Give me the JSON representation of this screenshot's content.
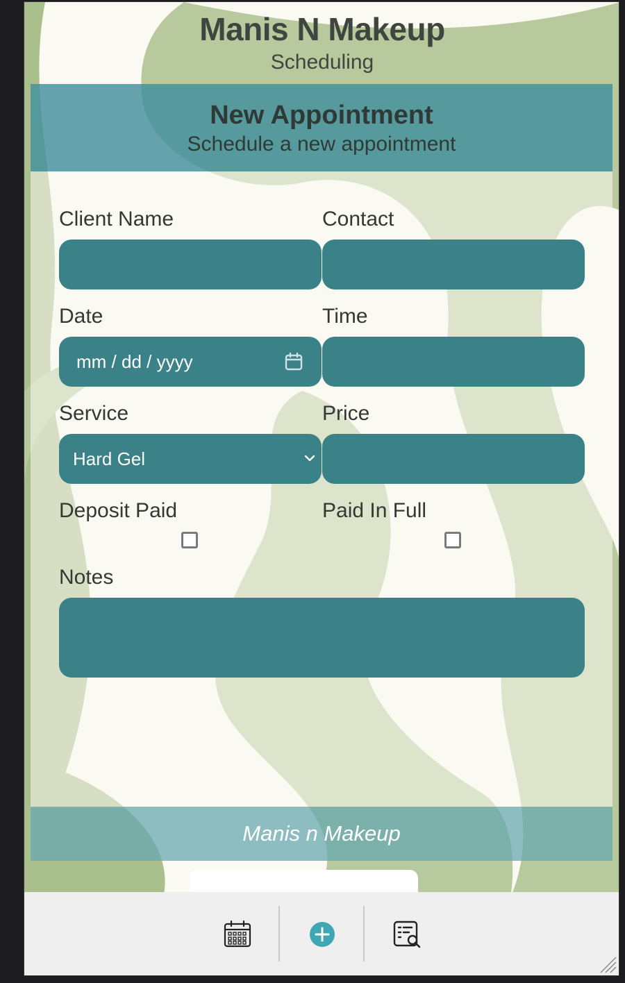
{
  "app": {
    "title": "Manis N Makeup",
    "subtitle": "Scheduling"
  },
  "header": {
    "title": "New Appointment",
    "subtitle": "Schedule a new appointment"
  },
  "form": {
    "client_name_label": "Client Name",
    "client_name_value": "",
    "contact_label": "Contact",
    "contact_value": "",
    "date_label": "Date",
    "date_placeholder": "mm / dd / yyyy",
    "time_label": "Time",
    "time_value": "",
    "service_label": "Service",
    "service_selected": "Hard Gel",
    "price_label": "Price",
    "price_value": "",
    "deposit_paid_label": "Deposit Paid",
    "deposit_paid_checked": false,
    "paid_in_full_label": "Paid In Full",
    "paid_in_full_checked": false,
    "notes_label": "Notes",
    "notes_value": ""
  },
  "footer": {
    "text": "Manis n Makeup"
  },
  "bottom_nav": {
    "items": [
      {
        "icon": "calendar-icon"
      },
      {
        "icon": "add-circle-icon"
      },
      {
        "icon": "search-list-icon"
      }
    ]
  },
  "colors": {
    "field_bg": "#3a8188",
    "header_band": "#42909e",
    "footer_band": "#68a8b0",
    "bg_sage": "#a9bf8c",
    "bg_cream": "#fbfaf2",
    "add_button": "#3fa7b3"
  }
}
